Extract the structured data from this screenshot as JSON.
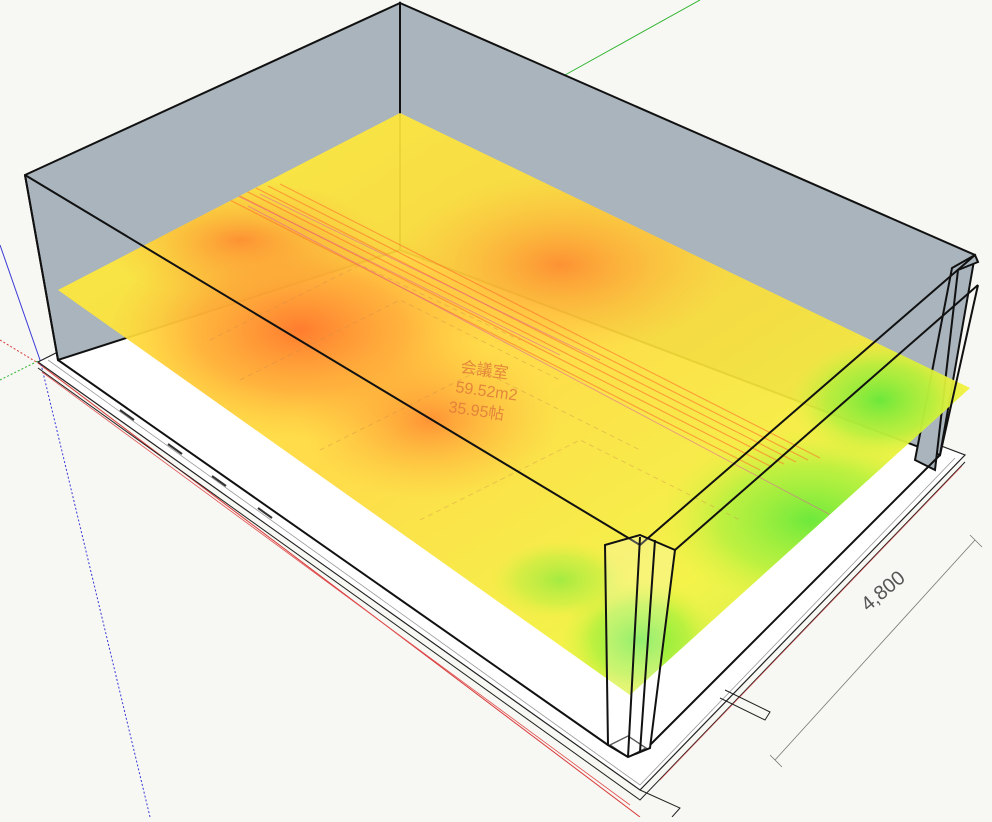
{
  "scene": {
    "background_color": "#f7f7f3",
    "wall_color": "#a9b4bc",
    "floor_color": "#ffffff",
    "axis_colors": {
      "red": "#d83a3a",
      "green": "#2fb52f",
      "blue": "#3a3ad8"
    },
    "heatmap_colors": [
      "#ff8a33",
      "#ffb13a",
      "#fff23a",
      "#a8f03a",
      "#5ee83a"
    ]
  },
  "room": {
    "label_name": "会議室",
    "label_area": "59.52m2",
    "label_tatami": "35.95帖"
  },
  "dimensions": {
    "side_length": "4,800"
  }
}
